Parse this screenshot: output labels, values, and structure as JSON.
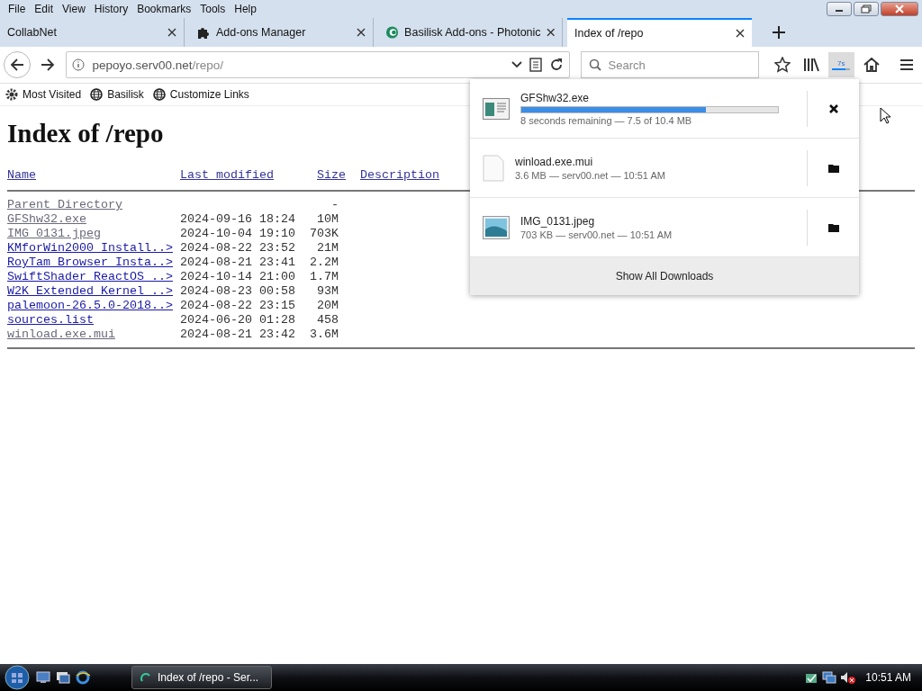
{
  "menu_bar": [
    "File",
    "Edit",
    "View",
    "History",
    "Bookmarks",
    "Tools",
    "Help"
  ],
  "tabs": [
    {
      "title": "CollabNet",
      "kind": "plain",
      "selected": false
    },
    {
      "title": "Add-ons Manager",
      "kind": "addons",
      "selected": false
    },
    {
      "title": "Basilisk Add-ons - Photonic",
      "kind": "site",
      "selected": false
    },
    {
      "title": "Index of /repo",
      "kind": "plain",
      "selected": true
    }
  ],
  "address_bar": {
    "host": "pepoyo.serv00.net",
    "path": "/repo/"
  },
  "search": {
    "placeholder": "Search"
  },
  "download_button": {
    "badge": "7s",
    "level": 0.72
  },
  "bookmarks": [
    {
      "label": "Most Visited",
      "kind": "gear"
    },
    {
      "label": "Basilisk",
      "kind": "globe"
    },
    {
      "label": "Customize Links",
      "kind": "globe"
    }
  ],
  "page": {
    "title": "Index of /repo",
    "columns": [
      "Name",
      "Last modified",
      "Size",
      "Description"
    ],
    "rows": [
      {
        "name": "Parent Directory",
        "modified": "",
        "size": "-",
        "visited": true
      },
      {
        "name": "GFShw32.exe",
        "modified": "2024-09-16 18:24",
        "size": "10M",
        "visited": true
      },
      {
        "name": "IMG_0131.jpeg",
        "modified": "2024-10-04 19:10",
        "size": "703K",
        "visited": true
      },
      {
        "name": "KMforWin2000 Install..>",
        "modified": "2024-08-22 23:52",
        "size": "21M",
        "visited": false
      },
      {
        "name": "RoyTam Browser Insta..>",
        "modified": "2024-08-21 23:41",
        "size": "2.2M",
        "visited": false
      },
      {
        "name": "SwiftShader ReactOS ..>",
        "modified": "2024-10-14 21:00",
        "size": "1.7M",
        "visited": false
      },
      {
        "name": "W2K Extended Kernel ..>",
        "modified": "2024-08-23 00:58",
        "size": "93M",
        "visited": false
      },
      {
        "name": "palemoon-26.5.0-2018..>",
        "modified": "2024-08-22 23:15",
        "size": "20M",
        "visited": false
      },
      {
        "name": "sources.list",
        "modified": "2024-06-20 01:28",
        "size": "458",
        "visited": false
      },
      {
        "name": "winload.exe.mui",
        "modified": "2024-08-21 23:42",
        "size": "3.6M",
        "visited": true
      }
    ]
  },
  "downloads": {
    "items": [
      {
        "kind": "running",
        "file": "GFShw32.exe",
        "level": 0.72,
        "status": "8 seconds remaining — 7.5 of 10.4 MB"
      },
      {
        "kind": "document",
        "file": "winload.exe.mui",
        "status": "3.6 MB — serv00.net — 10:51 AM"
      },
      {
        "kind": "image",
        "file": "IMG_0131.jpeg",
        "status": "703 KB — serv00.net — 10:51 AM"
      }
    ],
    "footer": "Show All Downloads"
  },
  "taskbar": {
    "task": "Index of /repo - Ser...",
    "clock": "10:51 AM"
  }
}
